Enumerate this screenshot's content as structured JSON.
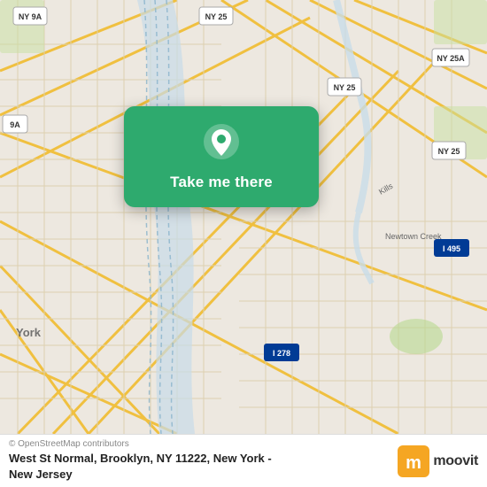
{
  "map": {
    "alt": "Map of Brooklyn and New York area",
    "center_lat": 40.705,
    "center_lon": -74.01
  },
  "card": {
    "button_label": "Take me there",
    "pin_alt": "location pin"
  },
  "footer": {
    "attribution": "© OpenStreetMap contributors",
    "location_line1": "West St Normal, Brooklyn, NY 11222, New York -",
    "location_line2": "New Jersey"
  },
  "moovit": {
    "wordmark": "moovit"
  }
}
